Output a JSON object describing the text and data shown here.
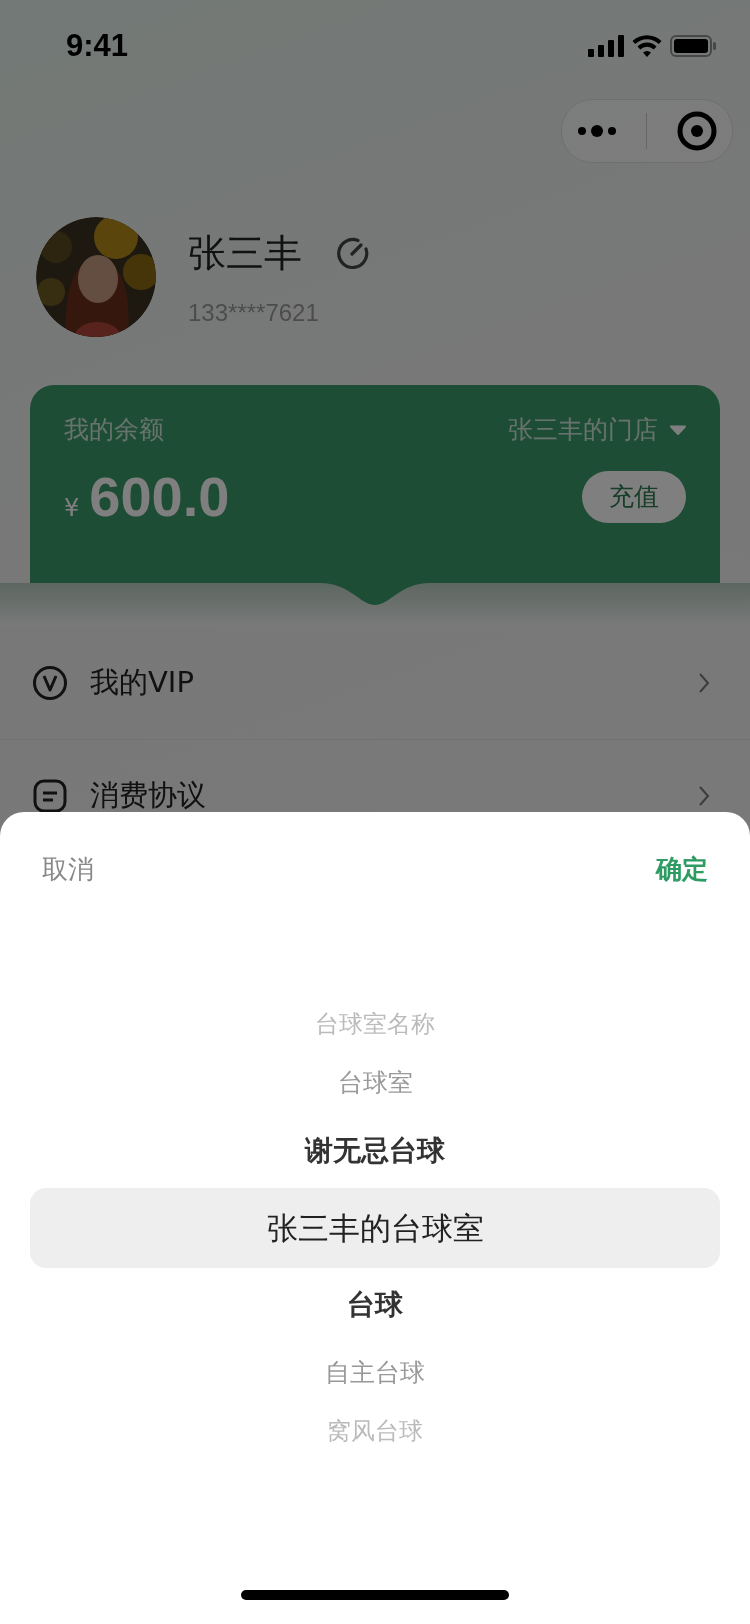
{
  "status_bar": {
    "time": "9:41"
  },
  "profile": {
    "name": "张三丰",
    "phone": "133****7621"
  },
  "balance_card": {
    "label": "我的余额",
    "store": "张三丰的门店",
    "currency": "¥",
    "amount": "600.0",
    "recharge_button": "充值"
  },
  "menu": [
    {
      "label": "我的VIP",
      "kind": "vip"
    },
    {
      "label": "消费协议",
      "kind": "doc"
    }
  ],
  "picker": {
    "cancel": "取消",
    "confirm": "确定",
    "options": [
      {
        "label": "台球室名称",
        "selected": false
      },
      {
        "label": "台球室",
        "selected": false
      },
      {
        "label": "谢无忌台球",
        "selected": false
      },
      {
        "label": "张三丰的台球室",
        "selected": true
      },
      {
        "label": "台球",
        "selected": false
      },
      {
        "label": "自主台球",
        "selected": false
      },
      {
        "label": "窝风台球",
        "selected": false
      }
    ]
  }
}
